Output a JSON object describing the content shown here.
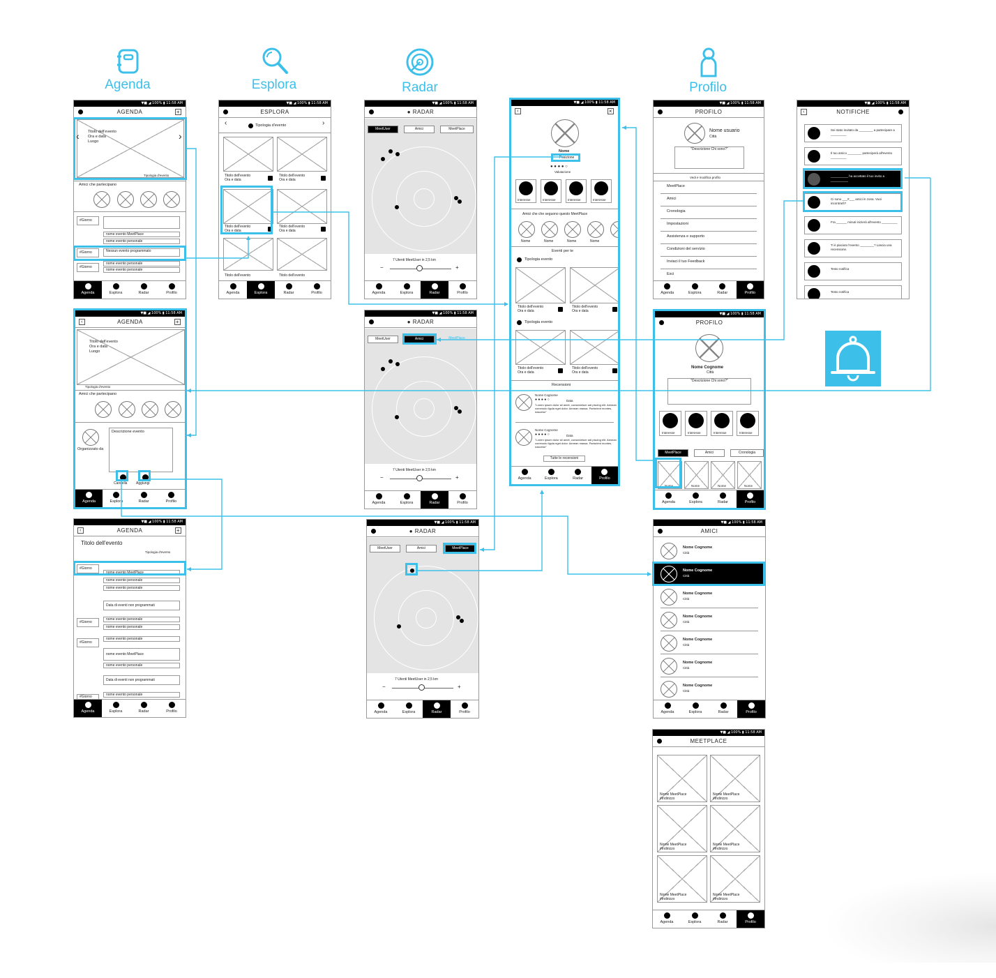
{
  "sections": {
    "agenda": "Agenda",
    "esplora": "Esplora",
    "radar": "Radar",
    "profilo": "Profilo"
  },
  "status_text": "▼■ ◢ 100% ▮ 11:58 AM",
  "nav": [
    "Agenda",
    "Esplora",
    "Radar",
    "Profilo"
  ],
  "icons": {
    "agenda": "notebook-icon",
    "esplora": "magnifier-icon",
    "radar": "radar-icon",
    "profilo": "person-icon",
    "notifiche": "bell-icon"
  },
  "agenda1": {
    "title": "AGENDA",
    "event_lines": [
      "Titolo dell'evento",
      "Ora e data",
      "Luogo"
    ],
    "tipologia": "Tipologia d'evento",
    "friends": "Amici che partecipano",
    "giorno": "#Giorno",
    "rows": [
      "nome evento MeetPlace",
      "nome evento personale"
    ],
    "none": "Nessun evento programmato",
    "rows2": [
      "nome evento personale",
      "nome evento personale"
    ]
  },
  "agenda2": {
    "title": "AGENDA",
    "event_lines": [
      "Titolo dell'evento",
      "Ora e data",
      "Luogo"
    ],
    "tipologia": "Tipologia d'evento",
    "friends": "Amici che partecipano",
    "org": "Organizzato da",
    "desc": "Descrizione evento",
    "btn1": "Cancella",
    "btn2": "Aggiungi"
  },
  "agenda3": {
    "title": "AGENDA",
    "event_title": "Titolo dell'evento",
    "tipologia": "Tipologia d'evento",
    "giorno": "#Giorno",
    "lines": [
      "nome evento MeetPlace",
      "nome evento personale",
      "nome evento personale",
      "Data di eventi non programmati",
      "nome evento personale",
      "nome evento personale",
      "nome evento personale",
      "nome evento MeetPlace",
      "nome evento personale",
      "Data di eventi non programmati",
      "nome evento personale"
    ]
  },
  "esplora": {
    "title": "ESPLORA",
    "filter": "Tipologia d'evento",
    "card_title": "Titolo dell'evento",
    "card_sub": "Ora e data"
  },
  "radar": {
    "title": "RADAR",
    "tabs": [
      "MeetUser",
      "Amici",
      "MeetPlace"
    ],
    "count": "7 Utenti MeetUser in 2,5 km",
    "slider_minus": "−",
    "slider_plus": "+"
  },
  "meetplace_detail": {
    "name": "Nome",
    "position": "Posizione",
    "rating": "Valutazione",
    "interest": "Interesse",
    "followers": "Amici che che seguono questo MeetPlace",
    "friend_name": "Nome",
    "events_for_you": "Eventi per te",
    "tipologia": "Tipologia evento",
    "card_title": "Titolo dell'evento",
    "card_sub": "Ora e data",
    "reviews": "Recensioni",
    "reviewer": "Nome Cognome",
    "review_date": "Data",
    "review_text": "\"Lorem ipsum dolor sit amet, consectetuer adi piscing elit. Aenean commodo ligula eget dolor. Aenean massa. Parturient montes, nascetur\"",
    "all_reviews": "Tutte le recensioni"
  },
  "profilo1": {
    "title": "PROFILO",
    "username": "Nome usuario",
    "city": "Città",
    "bio": "\"Descrizione Chi sono?\"",
    "edit": "Vedi e modifica profilo",
    "menu": [
      "MeetPlace",
      "Amici",
      "Cronologia",
      "Impostazioni",
      "Assistenza e supporto",
      "Condizioni del servizio",
      "Inviaci il tuo Feedback",
      "Esci"
    ]
  },
  "profilo2": {
    "title": "PROFILO",
    "name": "Nome Cognome",
    "city": "Città",
    "bio": "\"Descrizione Chi sono?\"",
    "interest": "Interesse",
    "tabs": [
      "MeetPlace",
      "Amici",
      "Cronologia"
    ],
    "card": "Nome"
  },
  "amici": {
    "title": "AMICI",
    "name": "Nome Cognome",
    "city": "Città"
  },
  "meetplace_list": {
    "title": "MEETPLACE",
    "card_line1": "Nome MeetPlace",
    "card_line2": "#Indirizzo"
  },
  "notifiche": {
    "title": "NOTIFICHE",
    "items": [
      "Sei stato invitato da ________ a partecipare a _________",
      "Il tuo amico ________ parteciperà all'evento _________",
      "__________ ha accettato il tuo invito a __________",
      "Ci sono ___#___ amici in zona. Vuoi incontrarli?",
      "Fra ______ minuti inizierà all'evento _________",
      "Ti è piaciuto l'evento ________? Lascia una recensione.",
      "Testo notifica",
      "Testo notifica"
    ]
  },
  "colors": {
    "accent": "#3cc0ea",
    "ink": "#000000",
    "map": "#e4e4e4"
  }
}
